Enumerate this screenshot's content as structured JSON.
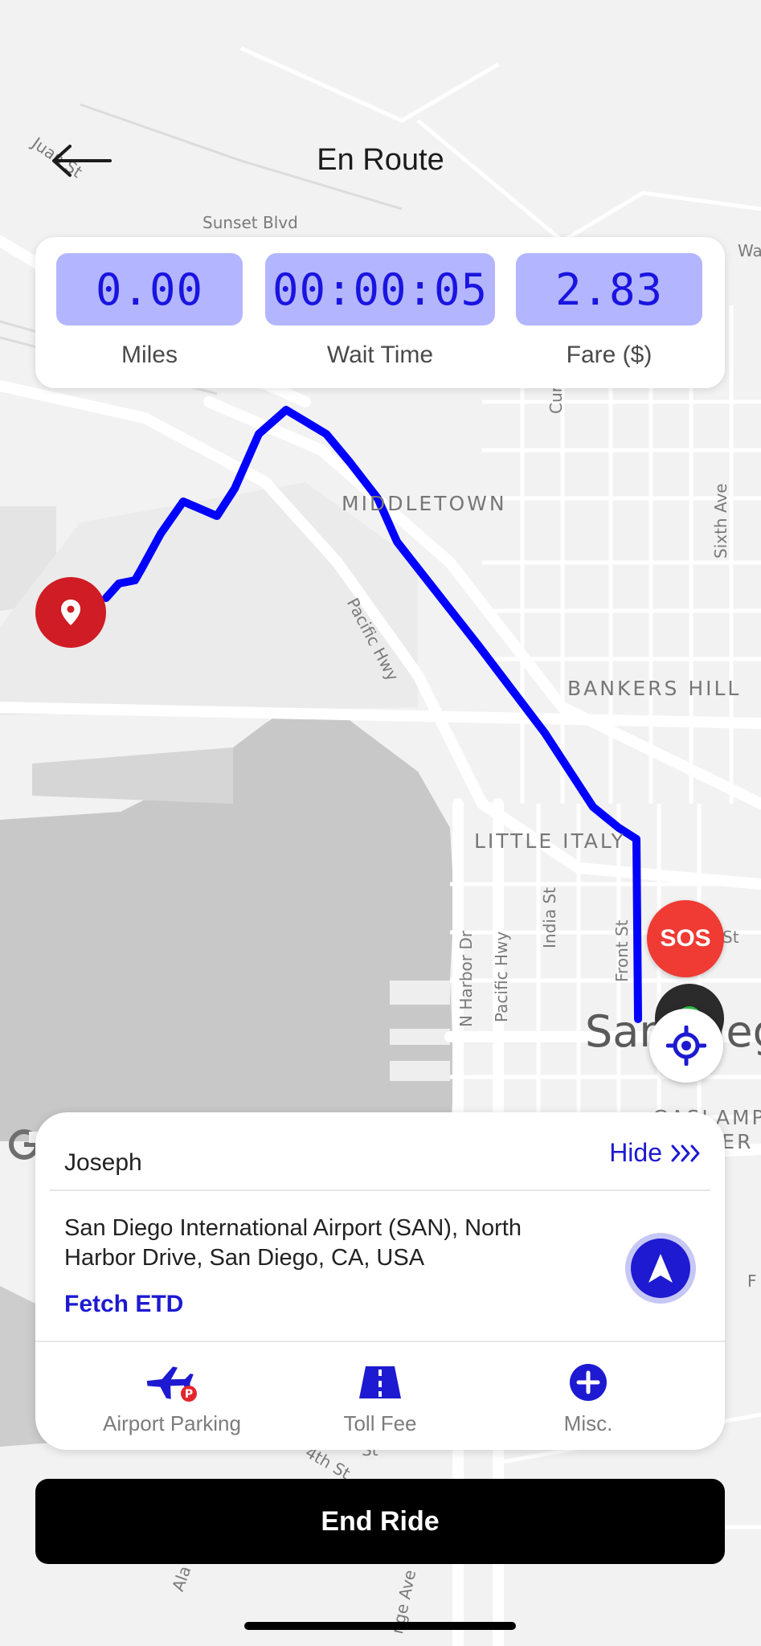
{
  "header": {
    "title": "En Route"
  },
  "stats": [
    {
      "value": "0.00",
      "label": "Miles"
    },
    {
      "value": "00:00:05",
      "label": "Wait Time"
    },
    {
      "value": "2.83",
      "label": "Fare ($)"
    }
  ],
  "map": {
    "districts": [
      "MIDDLETOWN",
      "BANKERS HILL",
      "LITTLE ITALY",
      "GASLAMP",
      "TER"
    ],
    "streets": [
      "Sunset Blvd",
      "Juan St",
      "Wa",
      "Curlew",
      "Sixth Ave",
      "Pacific Hwy",
      "Pacific Hwy",
      "N Harbor Dr",
      "India St",
      "Front St",
      "h St",
      "4th St",
      "St",
      "Ala",
      "nge Ave",
      "F"
    ],
    "city_label": "San Dieg"
  },
  "buttons": {
    "sos": "SOS"
  },
  "ride": {
    "rider_name": "Joseph",
    "hide_label": "Hide",
    "address": "San Diego International Airport (SAN), North Harbor Drive, San Diego, CA, USA",
    "fetch_etd": "Fetch ETD",
    "actions": [
      {
        "label": "Airport Parking",
        "icon": "airplane-parking-icon"
      },
      {
        "label": "Toll Fee",
        "icon": "road-icon"
      },
      {
        "label": "Misc.",
        "icon": "plus-circle-icon"
      }
    ]
  },
  "end_ride_label": "End Ride",
  "colors": {
    "accent": "#1d1ad1",
    "stat_box": "#b3b6ff",
    "route": "#0000ff",
    "sos": "#f03a34",
    "pin": "#d01c24"
  }
}
